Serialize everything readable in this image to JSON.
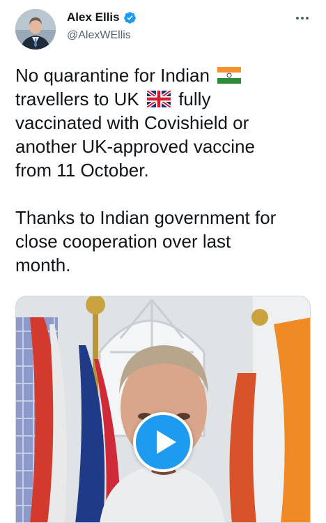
{
  "author": {
    "display_name": "Alex Ellis",
    "handle": "@AlexWEllis",
    "verified": true
  },
  "tweet": {
    "line_1": "No quarantine for Indian",
    "line_2a": "travellers to UK",
    "line_2b": "fully",
    "line_3": "vaccinated with Covishield or",
    "line_4": "another UK-approved vaccine",
    "line_5": "from 11 October.",
    "para_2_line_1": "Thanks to Indian government for",
    "para_2_line_2": "close cooperation over last",
    "para_2_line_3": "month."
  },
  "icons": {
    "india_flag": "flag-india-icon",
    "uk_flag": "flag-uk-icon",
    "verified": "verified-badge-icon",
    "more": "more-options-icon",
    "play": "play-icon"
  },
  "colors": {
    "verified_blue": "#1d9bf0",
    "play_blue": "#1d9bf0",
    "text": "#0f1419",
    "handle": "#536471"
  }
}
